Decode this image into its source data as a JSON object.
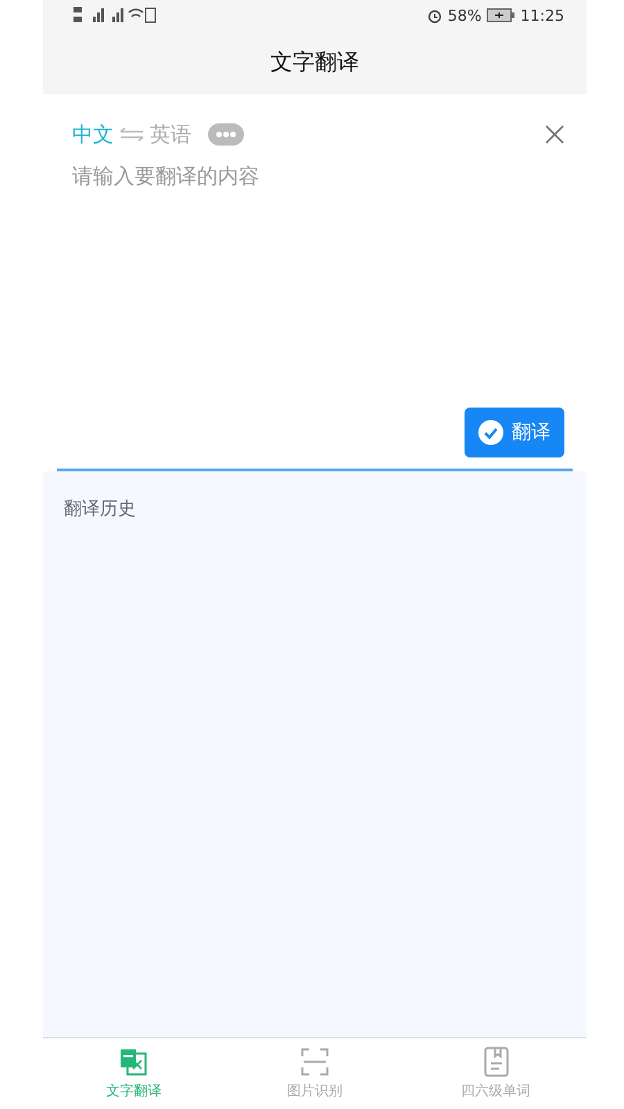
{
  "status_bar": {
    "battery": "58%",
    "time": "11:25"
  },
  "title": "文字翻译",
  "languages": {
    "source": "中文",
    "target": "英语"
  },
  "input": {
    "placeholder": "请输入要翻译的内容"
  },
  "translate_button": "翻译",
  "history": {
    "title": "翻译历史"
  },
  "nav": [
    {
      "label": "文字翻译",
      "selected": true,
      "kind": "translate"
    },
    {
      "label": "图片识别",
      "selected": false,
      "kind": "scan"
    },
    {
      "label": "四六级单词",
      "selected": false,
      "kind": "words"
    }
  ]
}
